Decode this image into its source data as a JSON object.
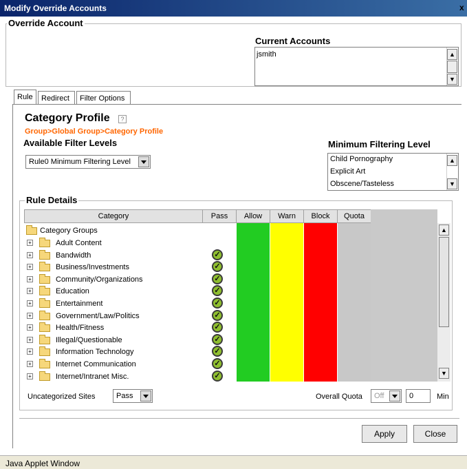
{
  "window": {
    "title": "Modify Override Accounts",
    "close_glyph": "x"
  },
  "override_account": {
    "group_title": "Override Account",
    "current_accounts_label": "Current Accounts",
    "accounts": [
      "jsmith"
    ]
  },
  "tabs": [
    {
      "label": "Rule",
      "active": true
    },
    {
      "label": "Redirect",
      "active": false
    },
    {
      "label": "Filter Options",
      "active": false
    }
  ],
  "profile": {
    "title": "Category Profile",
    "help_icon": "question-icon",
    "breadcrumb": "Group>Global Group>Category Profile",
    "breadcrumb_color": "#ff6600",
    "available_label": "Available Filter Levels",
    "selected_level": "Rule0 Minimum Filtering Level",
    "min_level_label": "Minimum Filtering Level",
    "min_levels": [
      "Child Pornography",
      "Explicit Art",
      "Obscene/Tasteless"
    ]
  },
  "rule_details": {
    "group_title": "Rule Details",
    "columns": [
      "Category",
      "Pass",
      "Allow",
      "Warn",
      "Block",
      "Quota"
    ],
    "colors": {
      "allow": "#22cc22",
      "warn": "#ffff00",
      "block": "#ff0000",
      "quota": "#c8c8c8"
    },
    "root": "Category Groups",
    "categories": [
      {
        "name": "Adult Content",
        "pass": false
      },
      {
        "name": "Bandwidth",
        "pass": true
      },
      {
        "name": "Business/Investments",
        "pass": true
      },
      {
        "name": "Community/Organizations",
        "pass": true
      },
      {
        "name": "Education",
        "pass": true
      },
      {
        "name": "Entertainment",
        "pass": true
      },
      {
        "name": "Government/Law/Politics",
        "pass": true
      },
      {
        "name": "Health/Fitness",
        "pass": true
      },
      {
        "name": "Illegal/Questionable",
        "pass": true
      },
      {
        "name": "Information Technology",
        "pass": true
      },
      {
        "name": "Internet Communication",
        "pass": true
      },
      {
        "name": "Internet/Intranet Misc.",
        "pass": true
      }
    ],
    "expander_glyph": "+",
    "uncategorized_label": "Uncategorized Sites",
    "uncategorized_value": "Pass",
    "overall_quota_label": "Overall Quota",
    "overall_quota_value": "Off",
    "min_value": "0",
    "min_label": "Min"
  },
  "buttons": {
    "apply": "Apply",
    "close": "Close"
  },
  "status": "Java Applet Window"
}
